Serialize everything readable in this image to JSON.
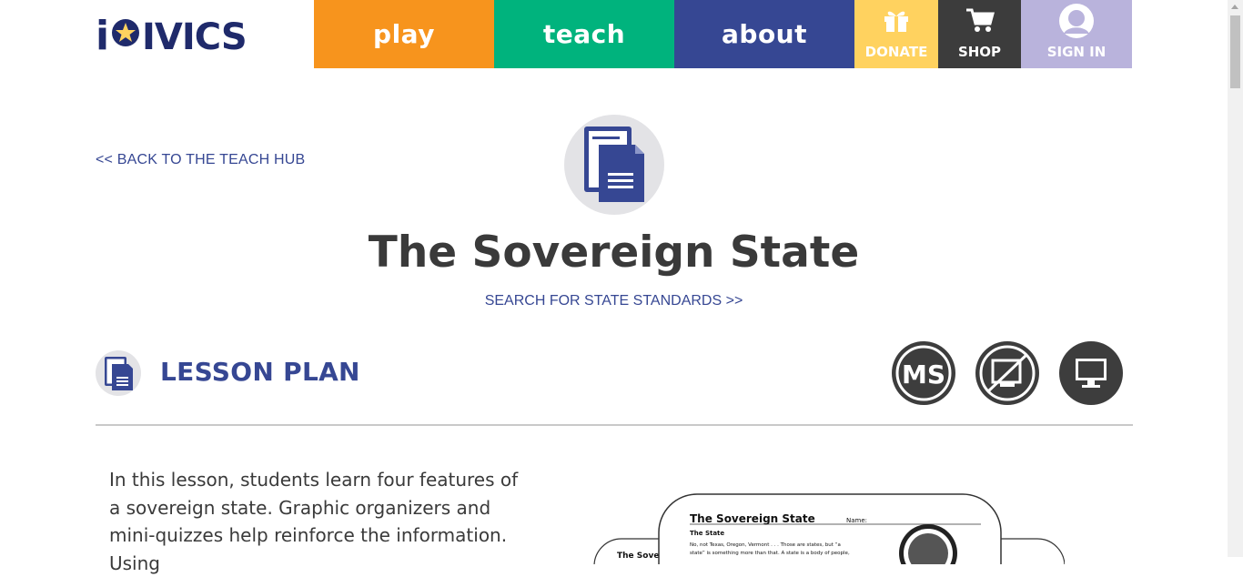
{
  "header": {
    "logo_text": "iCivics",
    "nav": {
      "play": "play",
      "teach": "teach",
      "about": "about",
      "donate": "DONATE",
      "shop": "SHOP",
      "signin": "SIGN IN"
    },
    "icons": {
      "donate": "gift-icon",
      "shop": "cart-icon",
      "signin": "user-avatar-icon"
    },
    "colors": {
      "play": "#f7941d",
      "teach": "#00b37d",
      "about": "#364793",
      "donate": "#ffd25f",
      "shop": "#3c3c3c",
      "signin": "#b9b3dc"
    }
  },
  "page": {
    "back_link": "<< BACK TO THE TEACH HUB",
    "title": "The Sovereign State",
    "standards_link": "SEARCH FOR STATE STANDARDS >>",
    "hero_icon": "document-icon"
  },
  "lesson": {
    "heading": "LESSON PLAN",
    "icon": "lesson-document-icon",
    "badges": [
      {
        "name": "middle-school-badge",
        "label": "MS"
      },
      {
        "name": "no-print-icon",
        "label": ""
      },
      {
        "name": "digital-monitor-icon",
        "label": ""
      }
    ],
    "description": "In this lesson, students learn four features of a sovereign state. Graphic organizers and mini-quizzes help reinforce the information. Using"
  },
  "preview": {
    "doc_title": "The Sovereign State",
    "name_label": "Name:",
    "section": "The State",
    "line1": "No, not Texas, Oregon, Vermont . . . Those are states, but “a",
    "line2": "state” is something more than that. A state is a body of people,",
    "back_doc_title": "The Sove..."
  }
}
